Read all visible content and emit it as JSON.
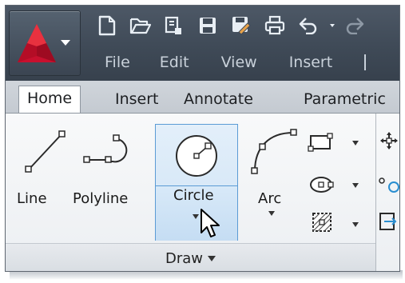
{
  "app": {
    "name": "AutoCAD",
    "brand_color": "#c8102e",
    "quick_access_icons": [
      "new-icon",
      "open-icon",
      "plot-icon",
      "save-icon",
      "save-as-icon",
      "print-icon",
      "undo-icon",
      "redo-icon"
    ]
  },
  "menubar": {
    "items": [
      "File",
      "Edit",
      "View",
      "Insert"
    ]
  },
  "ribbon": {
    "tabs": [
      "Home",
      "Insert",
      "Annotate",
      "Parametric"
    ],
    "active_tab": "Home",
    "draw_panel": {
      "title": "Draw",
      "tools": [
        {
          "label": "Line"
        },
        {
          "label": "Polyline"
        },
        {
          "label": "Circle",
          "state": "hover"
        },
        {
          "label": "Arc"
        }
      ],
      "small_tools": [
        "rectangle-icon",
        "ellipse-icon",
        "hatch-icon"
      ]
    }
  },
  "colors": {
    "titlebar": "#3f4a57",
    "menu_text": "#c9d1da",
    "hover_fill": "#cfe3f5",
    "hover_border": "#5b9bd5",
    "panel_bg": "#eceff2"
  }
}
